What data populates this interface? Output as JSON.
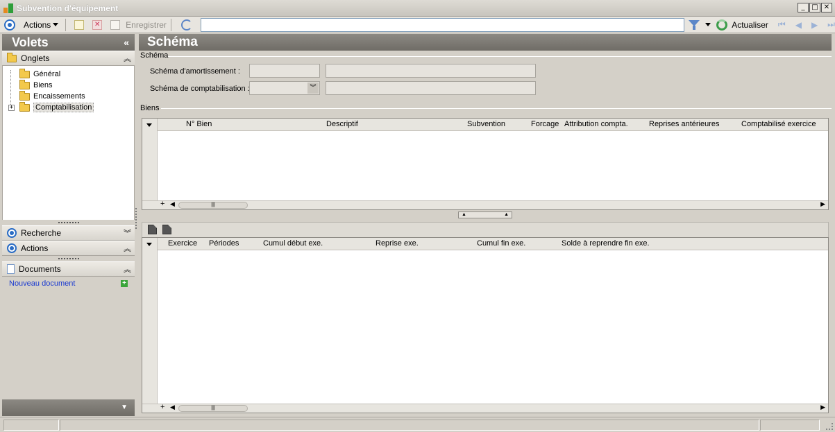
{
  "window": {
    "title": "Subvention d'équipement"
  },
  "toolbar": {
    "actions_label": "Actions",
    "save_label": "Enregistrer",
    "search_value": "",
    "refresh_label": "Actualiser",
    "nav": {
      "first": "⏮",
      "prev": "◀",
      "next": "▶",
      "last": "⏭"
    }
  },
  "left": {
    "title": "Volets",
    "collapse_icon": "«",
    "onglets": {
      "label": "Onglets",
      "items": [
        {
          "label": "Général"
        },
        {
          "label": "Biens"
        },
        {
          "label": "Encaissements"
        },
        {
          "label": "Comptabilisation",
          "expander": "+"
        }
      ]
    },
    "recherche": {
      "label": "Recherche"
    },
    "actions": {
      "label": "Actions"
    },
    "documents": {
      "label": "Documents",
      "new_doc": "Nouveau document",
      "add": "+"
    }
  },
  "main": {
    "title": "Schéma",
    "schema_section": "Schéma",
    "amortissement_label": "Schéma d'amortissement :",
    "amortissement_code": "",
    "amortissement_desc": "",
    "comptabilisation_label": "Schéma de comptabilisation :",
    "comptabilisation_code": "",
    "comptabilisation_desc": "",
    "biens_section": "Biens",
    "biens_columns": [
      "N° Bien",
      "Descriptif",
      "Subvention",
      "Forcage",
      "Attribution compta.",
      "Reprises antérieures",
      "Comptabilisé exercice"
    ],
    "periods_columns": [
      "Exercice",
      "Périodes",
      "Cumul début exe.",
      "Reprise exe.",
      "Cumul fin exe.",
      "Solde à reprendre fin exe."
    ]
  },
  "colors": {
    "panel_header": "#7e7b75",
    "window_bg": "#d4d0c8",
    "accent": "#2a6cc4"
  }
}
